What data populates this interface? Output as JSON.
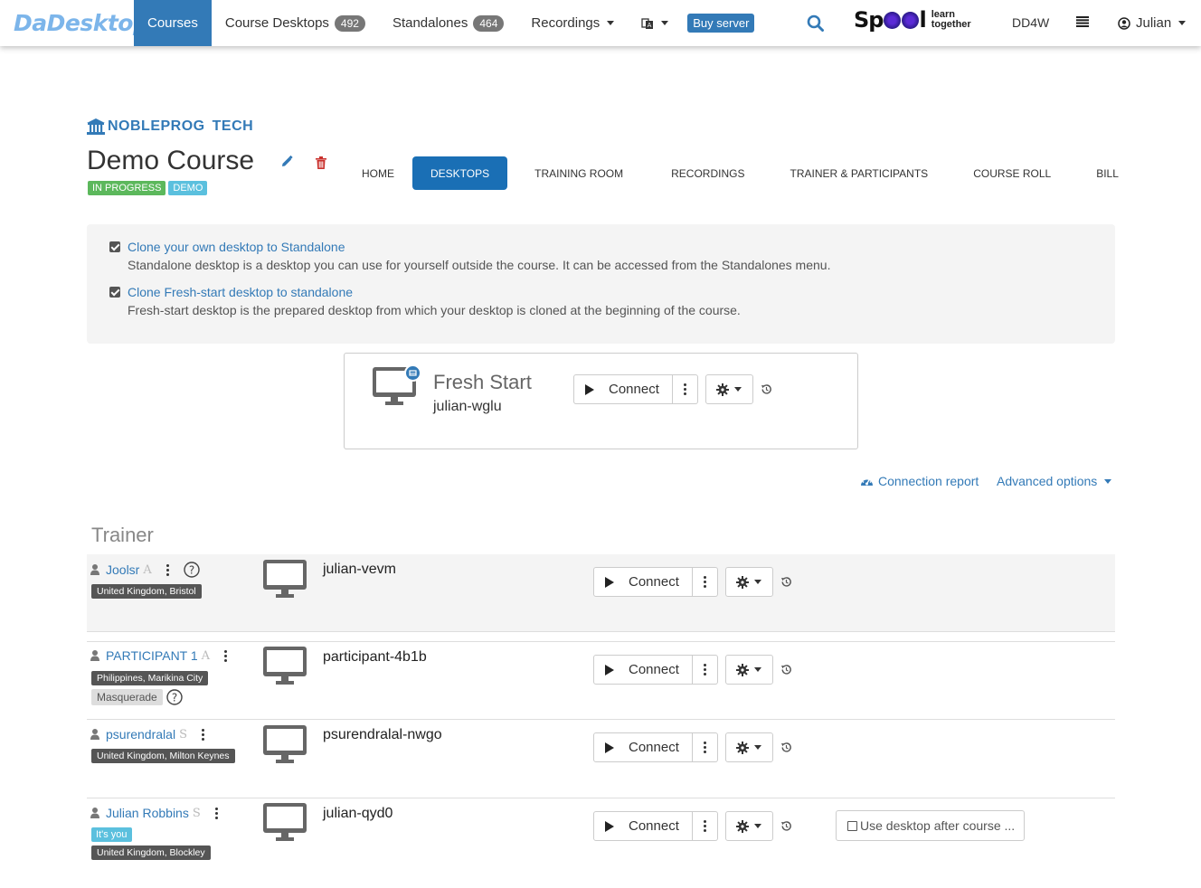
{
  "navbar": {
    "brand": "DaDesktop",
    "items": [
      {
        "label": "Courses"
      },
      {
        "label": "Course Desktops",
        "count": "492"
      },
      {
        "label": "Standalones",
        "count": "464"
      },
      {
        "label": "Recordings"
      }
    ],
    "buy_server": "Buy server",
    "spool": {
      "brand": "Spool",
      "tagline_1": "learn",
      "tagline_2": "together"
    },
    "dd4w": "DD4W",
    "user": "Julian"
  },
  "course": {
    "org_name": "NOBLEPROG",
    "org_tag": "TECH",
    "title": "Demo Course",
    "status": "IN PROGRESS",
    "type": "DEMO",
    "tabs": [
      "HOME",
      "DESKTOPS",
      "TRAINING ROOM",
      "RECORDINGS",
      "TRAINER & PARTICIPANTS",
      "COURSE ROLL",
      "BILL"
    ],
    "active_tab": "DESKTOPS"
  },
  "info": {
    "clone_own_link": "Clone your own desktop to Standalone",
    "clone_own_text": "Standalone desktop is a desktop you can use for yourself outside the course. It can be accessed from the Standalones menu.",
    "clone_fresh_link": "Clone Fresh-start desktop to standalone",
    "clone_fresh_text": "Fresh-start desktop is the prepared desktop from which your desktop is cloned at the beginning of the course."
  },
  "fresh_start": {
    "title": "Fresh Start",
    "desktop": "julian-wglu",
    "connect_label": "Connect"
  },
  "links": {
    "connection_report": "Connection report",
    "advanced_options": "Advanced options"
  },
  "trainer_heading": "Trainer",
  "rows": [
    {
      "name": "Joolsr",
      "role": "A",
      "location": "United Kingdom, Bristol",
      "desktop": "julian-vevm",
      "connect_label": "Connect"
    },
    {
      "name": "PARTICIPANT 1",
      "role": "A",
      "location": "Philippines, Marikina City",
      "extra": "Masquerade",
      "desktop": "participant-4b1b",
      "connect_label": "Connect"
    },
    {
      "name": "psurendralal",
      "role": "S",
      "location": "United Kingdom, Milton Keynes",
      "desktop": "psurendralal-nwgo",
      "connect_label": "Connect"
    },
    {
      "name": "Julian Robbins",
      "role": "S",
      "you_label": "It's you",
      "location": "United Kingdom, Blockley",
      "desktop": "julian-qyd0",
      "connect_label": "Connect",
      "use_after": "Use desktop after course ..."
    }
  ],
  "colors": {
    "primary": "#337ab7",
    "success": "#5cb85c",
    "info": "#5bc0de",
    "brand": "#7cb5ea"
  }
}
